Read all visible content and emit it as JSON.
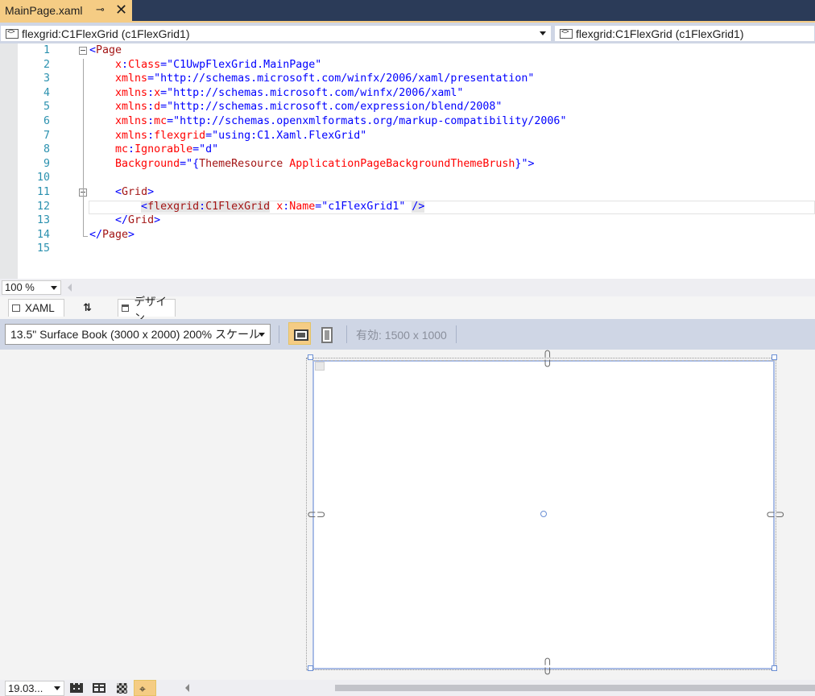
{
  "tab": {
    "title": "MainPage.xaml",
    "pin_glyph": "⊸",
    "close_glyph": "✕"
  },
  "navbar": {
    "left_combo": "flexgrid:C1FlexGrid (c1FlexGrid1)",
    "right_combo": "flexgrid:C1FlexGrid (c1FlexGrid1)"
  },
  "editor": {
    "line_numbers": [
      "1",
      "2",
      "3",
      "4",
      "5",
      "6",
      "7",
      "8",
      "9",
      "10",
      "11",
      "12",
      "13",
      "14",
      "15"
    ],
    "lines": [
      [
        {
          "t": "<",
          "c": "blue"
        },
        {
          "t": "Page",
          "c": "brown"
        }
      ],
      [
        {
          "t": "    "
        },
        {
          "t": "x",
          "c": "red"
        },
        {
          "t": ":",
          "c": "blue"
        },
        {
          "t": "Class",
          "c": "red"
        },
        {
          "t": "=\"",
          "c": "blue"
        },
        {
          "t": "C1UwpFlexGrid.MainPage",
          "c": "blue"
        },
        {
          "t": "\"",
          "c": "blue"
        }
      ],
      [
        {
          "t": "    "
        },
        {
          "t": "xmlns",
          "c": "red"
        },
        {
          "t": "=\"",
          "c": "blue"
        },
        {
          "t": "http://schemas.microsoft.com/winfx/2006/xaml/presentation",
          "c": "blue"
        },
        {
          "t": "\"",
          "c": "blue"
        }
      ],
      [
        {
          "t": "    "
        },
        {
          "t": "xmlns",
          "c": "red"
        },
        {
          "t": ":",
          "c": "blue"
        },
        {
          "t": "x",
          "c": "red"
        },
        {
          "t": "=\"",
          "c": "blue"
        },
        {
          "t": "http://schemas.microsoft.com/winfx/2006/xaml",
          "c": "blue"
        },
        {
          "t": "\"",
          "c": "blue"
        }
      ],
      [
        {
          "t": "    "
        },
        {
          "t": "xmlns",
          "c": "red"
        },
        {
          "t": ":",
          "c": "blue"
        },
        {
          "t": "d",
          "c": "red"
        },
        {
          "t": "=\"",
          "c": "blue"
        },
        {
          "t": "http://schemas.microsoft.com/expression/blend/2008",
          "c": "blue"
        },
        {
          "t": "\"",
          "c": "blue"
        }
      ],
      [
        {
          "t": "    "
        },
        {
          "t": "xmlns",
          "c": "red"
        },
        {
          "t": ":",
          "c": "blue"
        },
        {
          "t": "mc",
          "c": "red"
        },
        {
          "t": "=\"",
          "c": "blue"
        },
        {
          "t": "http://schemas.openxmlformats.org/markup-compatibility/2006",
          "c": "blue"
        },
        {
          "t": "\"",
          "c": "blue"
        }
      ],
      [
        {
          "t": "    "
        },
        {
          "t": "xmlns",
          "c": "red"
        },
        {
          "t": ":",
          "c": "blue"
        },
        {
          "t": "flexgrid",
          "c": "red"
        },
        {
          "t": "=\"",
          "c": "blue"
        },
        {
          "t": "using:C1.Xaml.FlexGrid",
          "c": "blue"
        },
        {
          "t": "\"",
          "c": "blue"
        }
      ],
      [
        {
          "t": "    "
        },
        {
          "t": "mc",
          "c": "red"
        },
        {
          "t": ":",
          "c": "blue"
        },
        {
          "t": "Ignorable",
          "c": "red"
        },
        {
          "t": "=\"",
          "c": "blue"
        },
        {
          "t": "d",
          "c": "blue"
        },
        {
          "t": "\"",
          "c": "blue"
        }
      ],
      [
        {
          "t": "    "
        },
        {
          "t": "Background",
          "c": "red"
        },
        {
          "t": "=\"",
          "c": "blue"
        },
        {
          "t": "{",
          "c": "blue"
        },
        {
          "t": "ThemeResource",
          "c": "brown"
        },
        {
          "t": " "
        },
        {
          "t": "ApplicationPageBackgroundThemeBrush",
          "c": "red"
        },
        {
          "t": "}",
          "c": "blue"
        },
        {
          "t": "\"",
          "c": "blue"
        },
        {
          "t": ">",
          "c": "blue"
        }
      ],
      [],
      [
        {
          "t": "    "
        },
        {
          "t": "<",
          "c": "blue"
        },
        {
          "t": "Grid",
          "c": "brown"
        },
        {
          "t": ">",
          "c": "blue"
        }
      ],
      [
        {
          "t": "        "
        },
        {
          "t": "<",
          "c": "blue",
          "h": true
        },
        {
          "t": "flexgrid",
          "c": "brown",
          "h": true
        },
        {
          "t": ":",
          "c": "blue",
          "h": true
        },
        {
          "t": "C1FlexGrid",
          "c": "brown",
          "h": true
        },
        {
          "t": " "
        },
        {
          "t": "x",
          "c": "red"
        },
        {
          "t": ":",
          "c": "blue"
        },
        {
          "t": "Name",
          "c": "red"
        },
        {
          "t": "=\"",
          "c": "blue"
        },
        {
          "t": "c1FlexGrid1",
          "c": "blue"
        },
        {
          "t": "\"",
          "c": "blue"
        },
        {
          "t": " "
        },
        {
          "t": "/>",
          "c": "blue",
          "h": true
        }
      ],
      [
        {
          "t": "    "
        },
        {
          "t": "</",
          "c": "blue"
        },
        {
          "t": "Grid",
          "c": "brown"
        },
        {
          "t": ">",
          "c": "blue"
        }
      ],
      [
        {
          "t": "</",
          "c": "blue"
        },
        {
          "t": "Page",
          "c": "brown"
        },
        {
          "t": ">",
          "c": "blue"
        }
      ],
      []
    ]
  },
  "zoom": {
    "value": "100 %"
  },
  "split_tabs": {
    "xaml": "XAML",
    "swap": "⇅",
    "design": "デザイン"
  },
  "designer": {
    "device": "13.5\" Surface Book (3000 x 2000) 200% スケール",
    "effective_size": "有効: 1500 x 1000"
  },
  "bottom": {
    "zoom_value": "19.03..."
  },
  "colors": {
    "accent": "#f5cc84",
    "tabstrip": "#2b3b58",
    "toolbar": "#cfd6e5"
  },
  "icons": {
    "landscape": "landscape-icon",
    "portrait": "portrait-icon",
    "snap": "snap-to-gridlines-icon"
  }
}
